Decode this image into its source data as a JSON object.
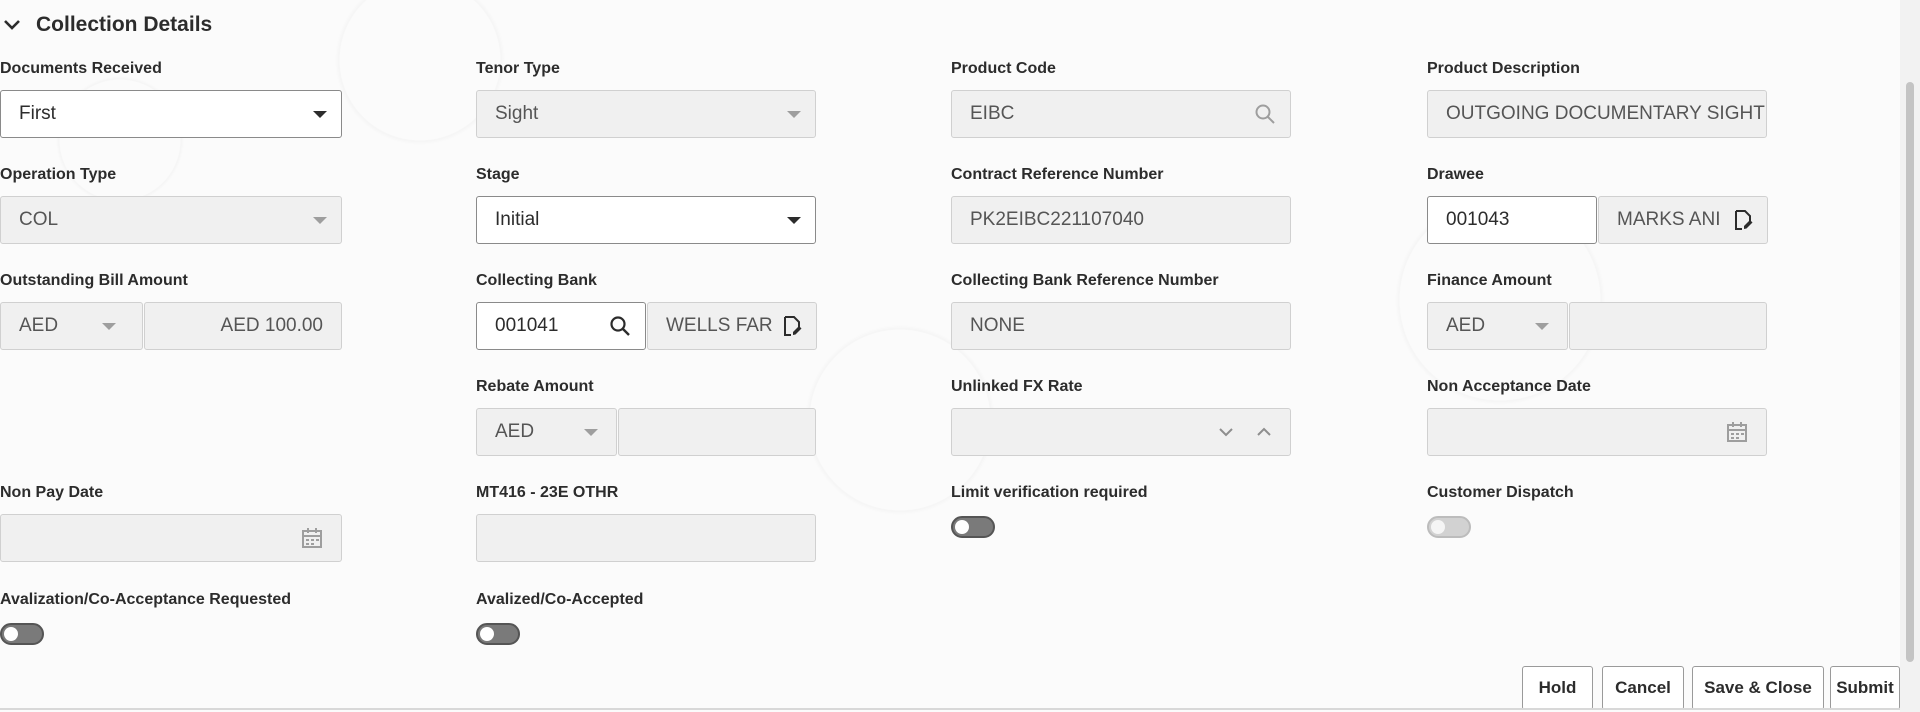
{
  "section": {
    "title": "Collection Details"
  },
  "fields": {
    "documents_received": {
      "label": "Documents Received",
      "value": "First"
    },
    "tenor_type": {
      "label": "Tenor Type",
      "value": "Sight"
    },
    "product_code": {
      "label": "Product Code",
      "value": "EIBC"
    },
    "product_description": {
      "label": "Product Description",
      "value": "OUTGOING DOCUMENTARY SIGHT"
    },
    "operation_type": {
      "label": "Operation Type",
      "value": "COL"
    },
    "stage": {
      "label": "Stage",
      "value": "Initial"
    },
    "contract_reference_number": {
      "label": "Contract Reference Number",
      "value": "PK2EIBC221107040"
    },
    "drawee": {
      "label": "Drawee",
      "id": "001043",
      "name": "MARKS ANI"
    },
    "outstanding_bill_amount": {
      "label": "Outstanding Bill Amount",
      "currency": "AED",
      "amount": "AED 100.00"
    },
    "collecting_bank": {
      "label": "Collecting Bank",
      "id": "001041",
      "name": "WELLS FAR"
    },
    "collecting_bank_reference_number": {
      "label": "Collecting Bank Reference Number",
      "value": "NONE"
    },
    "finance_amount": {
      "label": "Finance Amount",
      "currency": "AED",
      "amount": ""
    },
    "rebate_amount": {
      "label": "Rebate Amount",
      "currency": "AED",
      "amount": ""
    },
    "unlinked_fx_rate": {
      "label": "Unlinked FX Rate",
      "value": ""
    },
    "non_acceptance_date": {
      "label": "Non Acceptance Date",
      "value": ""
    },
    "non_pay_date": {
      "label": "Non Pay Date",
      "value": ""
    },
    "mt416_23e_othr": {
      "label": "MT416 - 23E OTHR",
      "value": ""
    },
    "limit_verification_required": {
      "label": "Limit verification required"
    },
    "customer_dispatch": {
      "label": "Customer Dispatch"
    },
    "avalization_requested": {
      "label": "Avalization/Co-Acceptance Requested"
    },
    "avalized_co_accepted": {
      "label": "Avalized/Co-Accepted"
    }
  },
  "footer": {
    "hold": "Hold",
    "cancel": "Cancel",
    "save_close": "Save & Close",
    "submit": "Submit"
  },
  "icons": {
    "chevron": "chevron-down-icon",
    "search": "search-icon",
    "lookup": "document-edit-icon",
    "calendar": "calendar-icon",
    "spinner": "spinner-arrows-icon"
  },
  "colors": {
    "text": "#2c2c2c",
    "field_disabled_bg": "#f0f0f0",
    "toggle_on": "#7a7a7a"
  }
}
